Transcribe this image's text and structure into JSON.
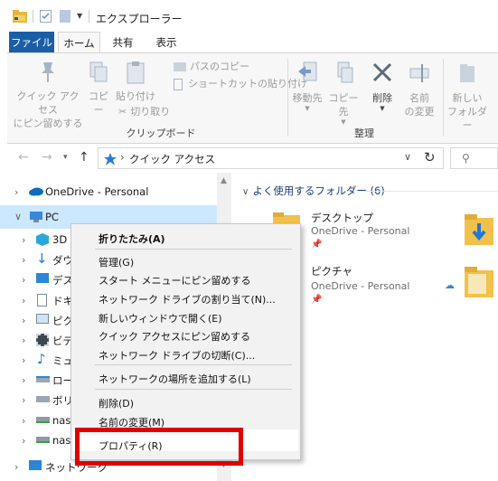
{
  "window": {
    "title": "エクスプローラー"
  },
  "ribbon": {
    "tabs": [
      "ファイル",
      "ホーム",
      "共有",
      "表示"
    ],
    "clipboard": {
      "pin_line1": "クイック アクセス",
      "pin_line2": "にピン留めする",
      "copy": "コピー",
      "paste": "貼り付け",
      "copy_path": "パスのコピー",
      "paste_shortcut": "ショートカットの貼り付け",
      "cut": "切り取り",
      "group_label": "クリップボード"
    },
    "organize": {
      "move_to": "移動先",
      "copy_to": "コピー先",
      "delete": "削除",
      "rename_line1": "名前",
      "rename_line2": "の変更",
      "group_label": "整理"
    },
    "new": {
      "new_folder_line1": "新しい",
      "new_folder_line2": "フォルダー"
    }
  },
  "address": {
    "path": "クイック アクセス"
  },
  "nav": {
    "items": [
      {
        "label": "OneDrive - Personal"
      },
      {
        "label": "PC"
      },
      {
        "label": "3D"
      },
      {
        "label": "ダウ"
      },
      {
        "label": "デス"
      },
      {
        "label": "ドキ"
      },
      {
        "label": "ピク"
      },
      {
        "label": "ビデ"
      },
      {
        "label": "ミュ"
      },
      {
        "label": "ロー"
      },
      {
        "label": "ボリ"
      },
      {
        "label": "nas_"
      },
      {
        "label": "nas_"
      },
      {
        "label": "ネットワーク"
      }
    ]
  },
  "content": {
    "section": "よく使用するフォルダー (6)",
    "tiles": [
      {
        "name": "デスクトップ",
        "sub": "OneDrive - Personal"
      },
      {
        "name": "ピクチャ",
        "sub": "OneDrive - Personal"
      }
    ]
  },
  "context_menu": {
    "items": [
      "折りたたみ(A)",
      "管理(G)",
      "スタート メニューにピン留めする",
      "ネットワーク ドライブの割り当て(N)...",
      "新しいウィンドウで開く(E)",
      "クイック アクセスにピン留めする",
      "ネットワーク ドライブの切断(C)...",
      "ネットワークの場所を追加する(L)",
      "削除(D)",
      "名前の変更(M)",
      "プロパティ(R)"
    ]
  },
  "colors": {
    "accent": "#1a5ea8",
    "selection": "#cce8ff",
    "highlight_box": "#e00000",
    "folder": "#f7c948"
  }
}
